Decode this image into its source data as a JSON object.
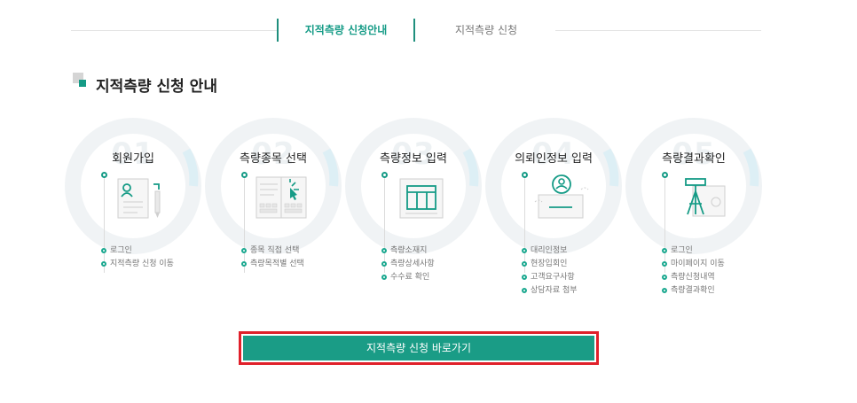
{
  "tabs": [
    {
      "label": "지적측량 신청안내",
      "active": true
    },
    {
      "label": "지적측량 신청",
      "active": false
    }
  ],
  "section": {
    "title": "지적측량 신청 안내"
  },
  "steps": [
    {
      "num": "01",
      "title": "회원가입",
      "icon": "user-document-icon",
      "items": [
        "로그인",
        "지적측량 신청 이동"
      ]
    },
    {
      "num": "02",
      "title": "측량종목 선택",
      "icon": "keyboard-select-icon",
      "items": [
        "종목 직접 선택",
        "측량목적별 선택"
      ]
    },
    {
      "num": "03",
      "title": "측량정보 입력",
      "icon": "table-form-icon",
      "items": [
        "측량소재지",
        "측량상세사항",
        "수수료 확인"
      ]
    },
    {
      "num": "04",
      "title": "의뢰인정보 입력",
      "icon": "client-info-icon",
      "items": [
        "대리인정보",
        "현장입회인",
        "고객요구사항",
        "상담자료 첨부"
      ]
    },
    {
      "num": "05",
      "title": "측량결과확인",
      "icon": "survey-tripod-icon",
      "items": [
        "로그인",
        "마이페이지 이동",
        "측량신청내역",
        "측량결과확인"
      ]
    }
  ],
  "cta": {
    "label": "지적측량 신청 바로가기"
  },
  "colors": {
    "accent": "#159b86",
    "highlight": "#e0202a"
  }
}
